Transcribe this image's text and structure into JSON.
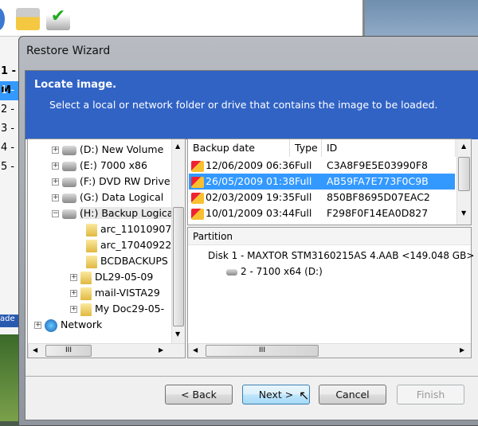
{
  "background_window": {
    "rows": [
      "1 - M",
      "1 -",
      "2 -",
      "3 -",
      "4 -",
      "5 -"
    ],
    "side_text": "ade"
  },
  "dialog": {
    "title": "Restore Wizard",
    "header": {
      "title": "Locate image.",
      "subtitle": "Select a local or network folder or drive that contains the image to be loaded."
    },
    "tree": [
      {
        "label": "(D:) New Volume",
        "icon": "windows-drive-icon",
        "expander": "+"
      },
      {
        "label": "(E:) 7000 x86",
        "icon": "drive-icon",
        "expander": "+"
      },
      {
        "label": "(F:) DVD RW Drive",
        "icon": "dvd-drive-icon",
        "expander": "+"
      },
      {
        "label": "(G:) Data Logical",
        "icon": "drive-icon",
        "expander": "+"
      },
      {
        "label": "(H:) Backup Logical",
        "icon": "drive-icon",
        "expander": "−"
      },
      {
        "label": "arc_11010907",
        "icon": "folder-icon",
        "expander": ""
      },
      {
        "label": "arc_17040922",
        "icon": "folder-icon",
        "expander": ""
      },
      {
        "label": "BCDBACKUPS",
        "icon": "folder-icon",
        "expander": ""
      },
      {
        "label": "DL29-05-09",
        "icon": "folder-icon",
        "expander": "+"
      },
      {
        "label": "mail-VISTA29",
        "icon": "folder-icon",
        "expander": "+"
      },
      {
        "label": "My Doc29-05-",
        "icon": "folder-icon",
        "expander": "+"
      },
      {
        "label": "Network",
        "icon": "network-icon",
        "expander": "+"
      }
    ],
    "backups": {
      "columns": [
        "Backup date",
        "Type",
        "ID"
      ],
      "rows": [
        {
          "date": "12/06/2009 06:36",
          "type": "Full",
          "id": "C3A8F9E5E03990F8",
          "selected": false
        },
        {
          "date": "26/05/2009 01:38",
          "type": "Full",
          "id": "AB59FA7E773F0C9B",
          "selected": true
        },
        {
          "date": "02/03/2009 19:35",
          "type": "Full",
          "id": "850BF8695D07EAC2",
          "selected": false
        },
        {
          "date": "10/01/2009 03:44",
          "type": "Full",
          "id": "F298F0F14EA0D827",
          "selected": false
        }
      ]
    },
    "partition": {
      "header": "Partition",
      "disk": "Disk 1 - MAXTOR STM3160215AS 4.AAB  <149.048 GB>",
      "item": "2 - 7100 x64 (D:)"
    },
    "buttons": {
      "back": "< Back",
      "next": "Next >",
      "cancel": "Cancel",
      "finish": "Finish"
    },
    "scroll_glyph": "III"
  }
}
